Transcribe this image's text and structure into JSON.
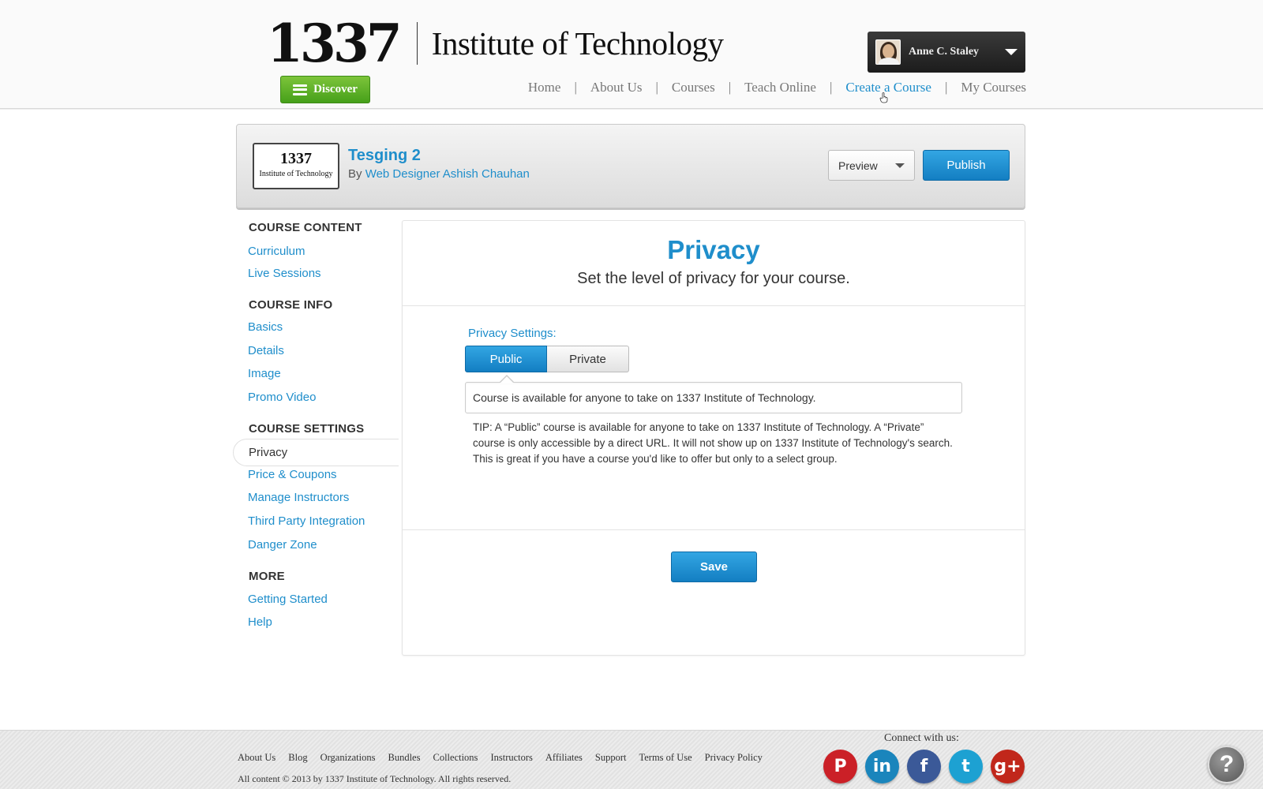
{
  "brand": {
    "number": "1337",
    "name": "Institute of Technology"
  },
  "discover_label": "Discover",
  "user": {
    "name": "Anne C. Staley"
  },
  "nav": [
    {
      "label": "Home",
      "active": false
    },
    {
      "label": "About Us",
      "active": false
    },
    {
      "label": "Courses",
      "active": false
    },
    {
      "label": "Teach Online",
      "active": false
    },
    {
      "label": "Create a Course",
      "active": true
    },
    {
      "label": "My Courses",
      "active": false
    }
  ],
  "nav_separator": "|",
  "course": {
    "logo_number": "1337",
    "logo_name": "Institute of Technology",
    "title": "Tesging 2",
    "by_prefix": "By",
    "author": "Web Designer Ashish Chauhan",
    "preview_label": "Preview",
    "publish_label": "Publish"
  },
  "sidebar": {
    "sections": [
      {
        "heading": "COURSE CONTENT",
        "items": [
          "Curriculum",
          "Live Sessions"
        ]
      },
      {
        "heading": "COURSE INFO",
        "items": [
          "Basics",
          "Details",
          "Image",
          "Promo Video"
        ]
      },
      {
        "heading": "COURSE SETTINGS",
        "items": [
          "Privacy",
          "Price & Coupons",
          "Manage Instructors",
          "Third Party Integration",
          "Danger Zone"
        ]
      },
      {
        "heading": "MORE",
        "items": [
          "Getting Started",
          "Help"
        ]
      }
    ],
    "active_item": "Privacy"
  },
  "main": {
    "title": "Privacy",
    "subtitle": "Set the level of privacy for your course.",
    "settings_label": "Privacy Settings:",
    "options": [
      "Public",
      "Private"
    ],
    "selected_option": "Public",
    "description": "Course is available for anyone to take on 1337 Institute of Technology.",
    "tip": "TIP: A “Public” course is available for anyone to take on 1337 Institute of Technology. A “Private” course is only accessible by a direct URL. It will not show up on 1337 Institute of Technology's search. This is great if you have a course you'd like to offer but only to a select group.",
    "save_label": "Save"
  },
  "footer": {
    "links": [
      "About Us",
      "Blog",
      "Organizations",
      "Bundles",
      "Collections",
      "Instructors",
      "Affiliates",
      "Support",
      "Terms of Use",
      "Privacy Policy"
    ],
    "copyright": "All content © 2013 by 1337 Institute of Technology. All rights reserved.",
    "connect_label": "Connect with us:",
    "social": [
      {
        "name": "pinterest-icon",
        "glyph": "P",
        "color": "#cb2027"
      },
      {
        "name": "linkedin-icon",
        "glyph": "in",
        "color": "#1a85bc"
      },
      {
        "name": "facebook-icon",
        "glyph": "f",
        "color": "#3b5998"
      },
      {
        "name": "twitter-icon",
        "glyph": "t",
        "color": "#1da1d2"
      },
      {
        "name": "googleplus-icon",
        "glyph": "g+",
        "color": "#c1271b"
      }
    ]
  },
  "help_glyph": "?",
  "colors": {
    "accent": "#1f8ecb",
    "discover_green": "#46a01a",
    "header_bg": "#fafafa"
  }
}
